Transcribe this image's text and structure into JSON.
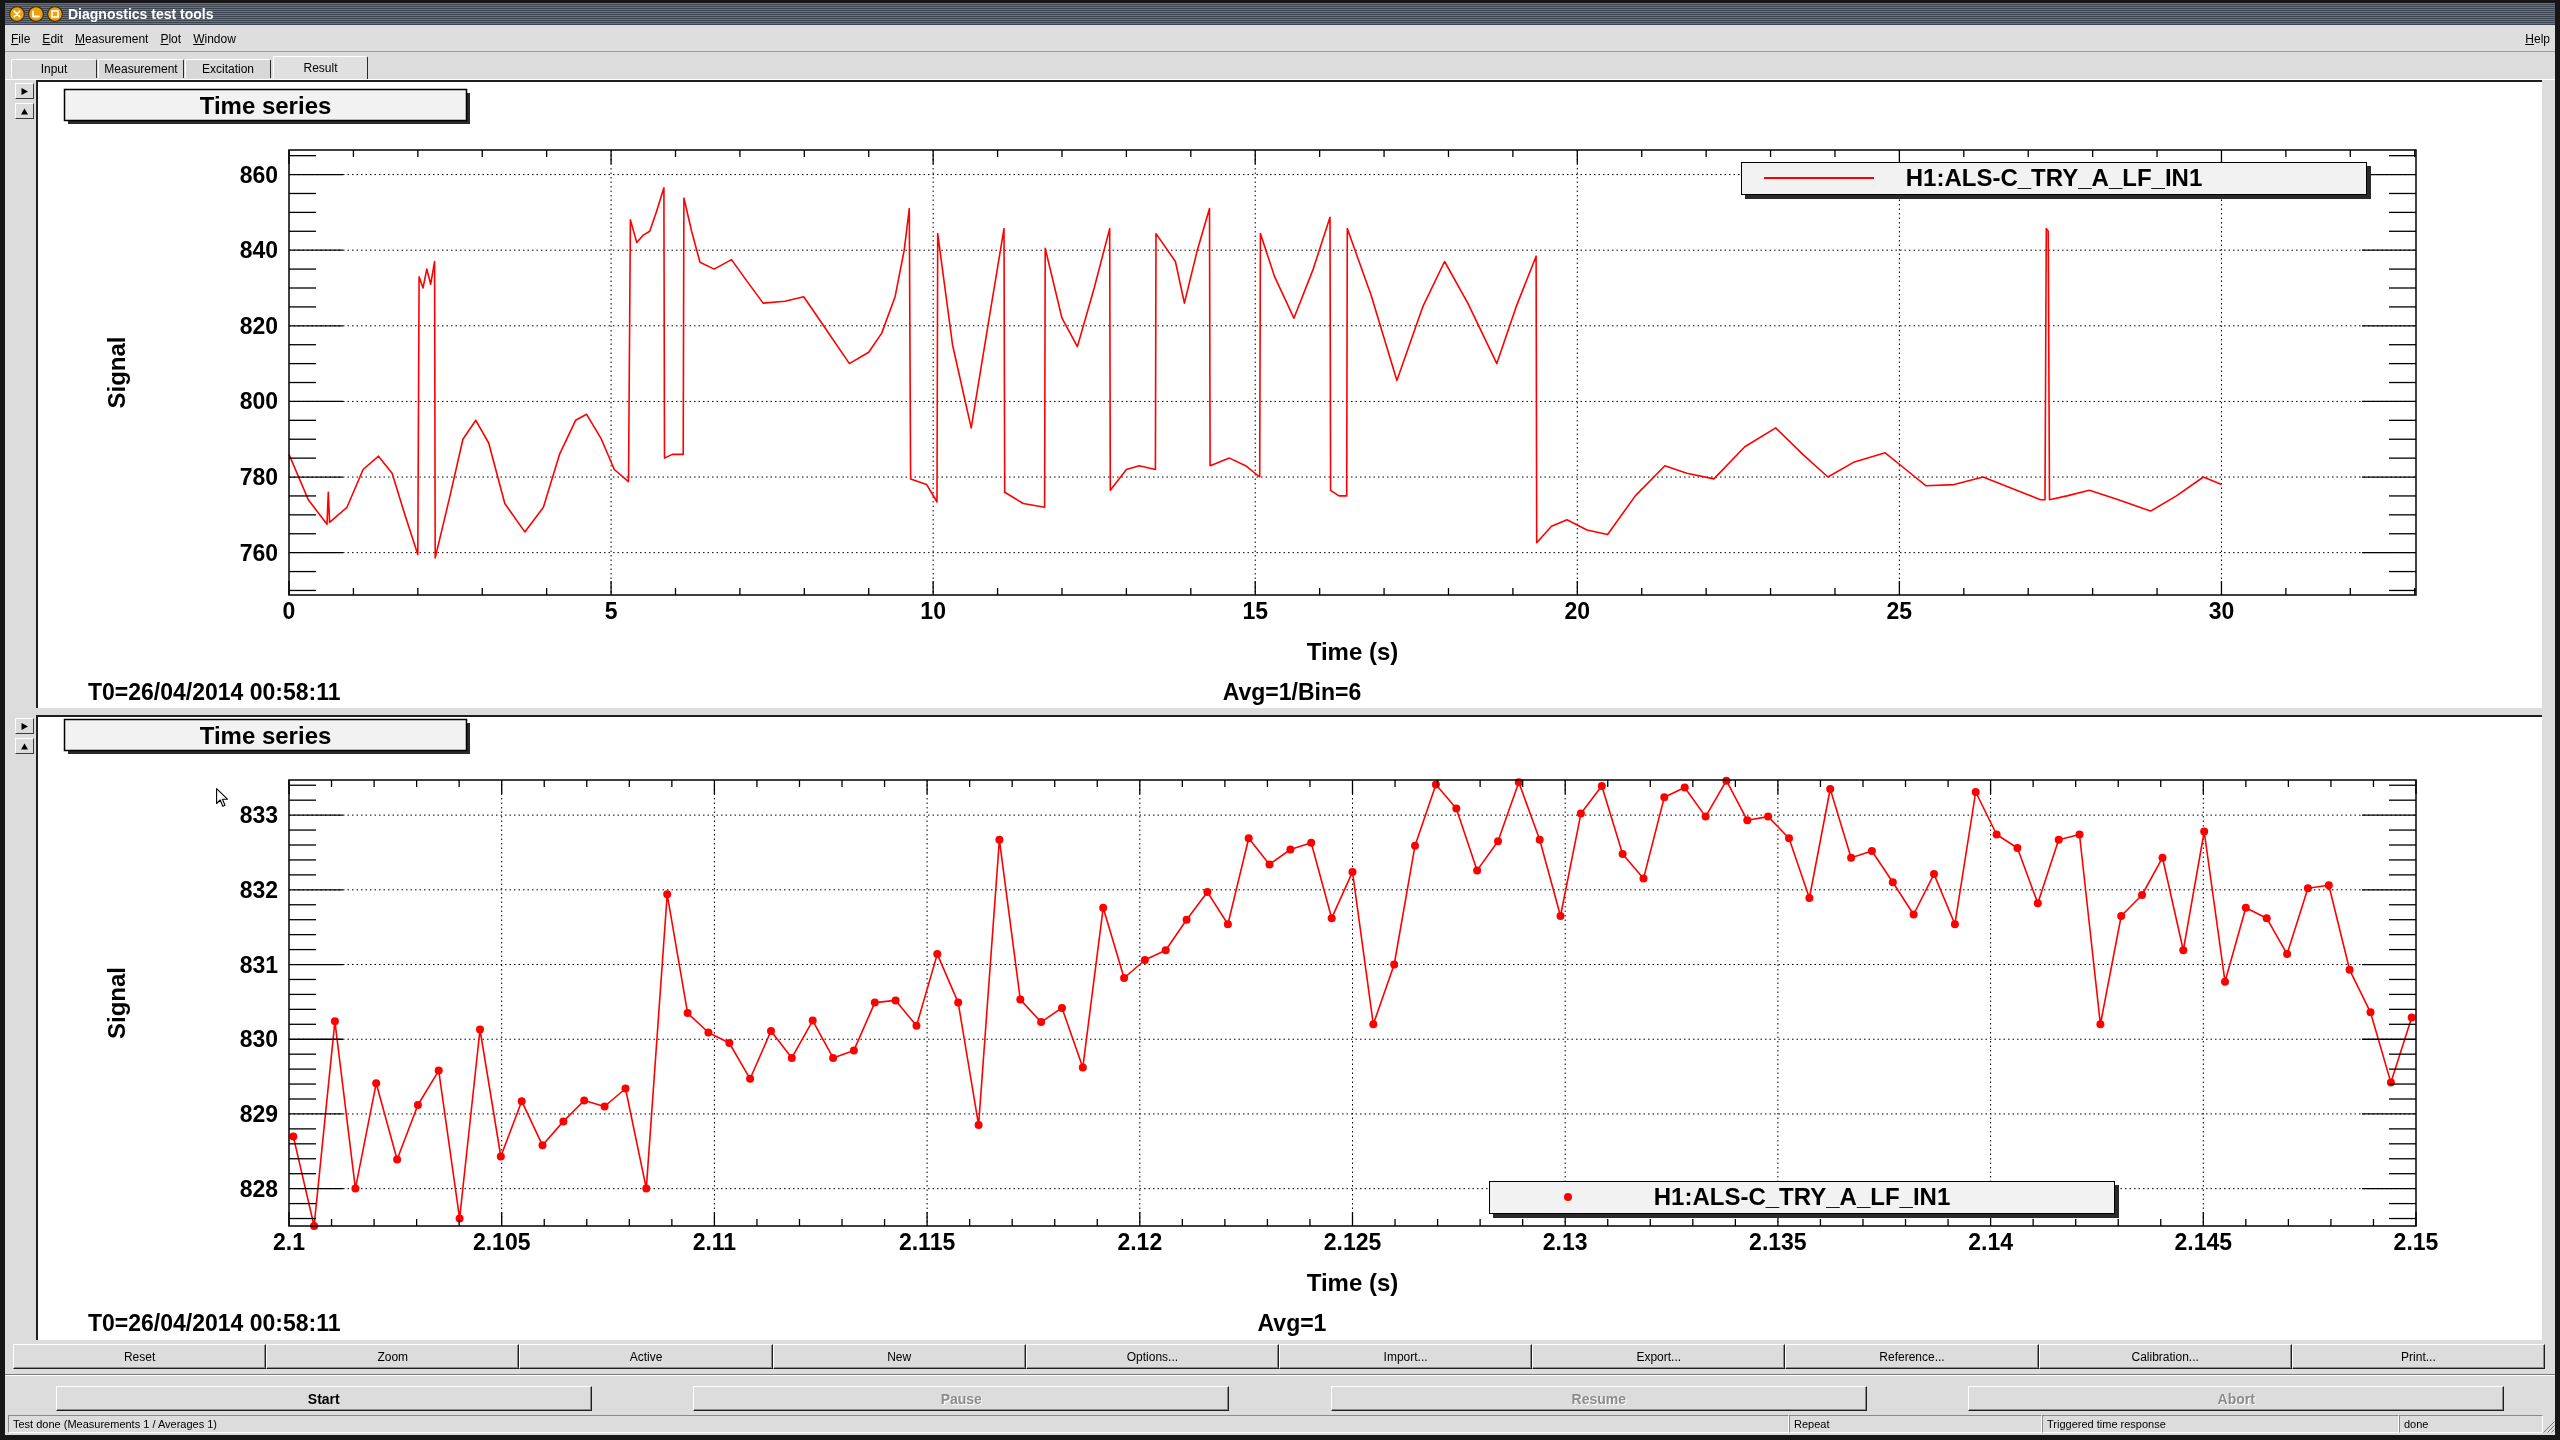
{
  "window": {
    "title": "Diagnostics test tools"
  },
  "menu": [
    "File",
    "Edit",
    "Measurement",
    "Plot",
    "Window"
  ],
  "help_menu": "Help",
  "tabs": [
    {
      "label": "Input",
      "selected": false
    },
    {
      "label": "Measurement",
      "selected": false
    },
    {
      "label": "Excitation",
      "selected": false
    },
    {
      "label": "Result",
      "selected": true
    }
  ],
  "plots": [
    {
      "start_time": "T0=26/04/2014 00:58:11",
      "averaging": "Avg=1/Bin=6",
      "chart_data": {
        "type": "line",
        "title": "Time series",
        "xlabel": "Time (s)",
        "ylabel": "Signal",
        "grid": true,
        "x": [
          0,
          0.3,
          0.59,
          0.61,
          0.63,
          0.9,
          1.15,
          1.39,
          1.6,
          1.8,
          2.0,
          2.02,
          2.08,
          2.14,
          2.2,
          2.26,
          2.27,
          2.5,
          2.7,
          2.9,
          3.1,
          3.35,
          3.66,
          3.95,
          4.2,
          4.45,
          4.62,
          4.85,
          5.05,
          5.27,
          5.3,
          5.4,
          5.5,
          5.6,
          5.7,
          5.82,
          5.83,
          5.95,
          6.12,
          6.13,
          6.25,
          6.38,
          6.6,
          6.87,
          7.1,
          7.36,
          7.7,
          7.99,
          8.3,
          8.7,
          9.0,
          9.2,
          9.41,
          9.55,
          9.63,
          9.65,
          9.9,
          10.06,
          10.07,
          10.3,
          10.59,
          10.85,
          11.1,
          11.11,
          11.4,
          11.73,
          11.74,
          12.0,
          12.24,
          12.5,
          12.74,
          12.75,
          13.0,
          13.2,
          13.45,
          13.46,
          13.76,
          13.9,
          14.1,
          14.29,
          14.3,
          14.6,
          14.85,
          15.07,
          15.08,
          15.3,
          15.6,
          15.9,
          16.16,
          16.17,
          16.3,
          16.42,
          16.43,
          16.8,
          17.2,
          17.6,
          17.94,
          18.3,
          18.75,
          19.05,
          19.36,
          19.37,
          19.6,
          19.84,
          20.15,
          20.47,
          20.9,
          21.36,
          21.7,
          22.12,
          22.6,
          23.08,
          23.5,
          23.89,
          24.3,
          24.78,
          25.1,
          25.41,
          25.85,
          26.3,
          26.75,
          27.19,
          27.26,
          27.28,
          27.31,
          27.33,
          27.6,
          27.95,
          28.4,
          28.9,
          29.3,
          29.72,
          30.0
        ],
        "series": [
          {
            "name": "H1:ALS-C_TRY_A_LF_IN1",
            "color": "#ff0000",
            "marker": "none",
            "values": [
              786,
              774,
              767.5,
              776,
              768,
              772,
              782,
              785.5,
              781,
              770,
              759.5,
              833,
              830,
              835,
              831,
              837,
              758.6,
              775,
              790,
              795,
              789,
              773,
              765.5,
              772,
              786,
              795,
              796.6,
              790,
              782,
              778.8,
              848,
              842,
              844,
              845,
              850,
              856.5,
              785,
              786,
              786,
              853.8,
              845,
              836.8,
              835,
              837.5,
              832,
              826,
              826.5,
              827.7,
              820,
              810,
              813,
              818,
              827.7,
              840,
              851,
              779.5,
              778,
              773.4,
              844.4,
              815,
              793,
              820,
              845.7,
              776,
              773,
              772,
              840.5,
              822,
              814.5,
              830,
              845.7,
              776.5,
              782,
              783,
              782,
              844.4,
              837,
              826,
              840,
              851,
              783,
              785,
              783,
              780,
              844.4,
              833,
              822,
              835,
              848.7,
              776.5,
              775,
              775,
              845.7,
              828,
              805.5,
              825,
              837,
              826,
              810,
              825,
              838.4,
              762.6,
              767,
              768.7,
              766,
              764.8,
              775,
              783,
              781,
              779.5,
              788,
              793,
              786,
              780,
              784,
              786.4,
              782,
              777.7,
              778,
              780,
              777,
              774,
              774,
              845.7,
              845,
              774,
              775,
              776.5,
              774,
              771,
              775,
              780,
              778
            ]
          }
        ],
        "xlim": [
          0,
          33.02
        ],
        "ylim": [
          748.8,
          866.5
        ],
        "xticks": [
          0,
          5,
          10,
          15,
          20,
          25,
          30
        ],
        "yticks": [
          760,
          780,
          800,
          820,
          840,
          860
        ]
      }
    },
    {
      "start_time": "T0=26/04/2014 00:58:11",
      "averaging": "Avg=1",
      "chart_data": {
        "type": "line",
        "title": "Time series",
        "xlabel": "Time (s)",
        "ylabel": "Signal",
        "grid": true,
        "x": [
          2.1001,
          2.10059,
          2.10108,
          2.10156,
          2.10205,
          2.10254,
          2.10303,
          2.10352,
          2.10401,
          2.10449,
          2.10498,
          2.10547,
          2.10596,
          2.10645,
          2.10694,
          2.10742,
          2.10791,
          2.1084,
          2.10889,
          2.10937,
          2.10986,
          2.11035,
          2.11084,
          2.11133,
          2.11182,
          2.11231,
          2.11279,
          2.11328,
          2.11377,
          2.11426,
          2.11475,
          2.11524,
          2.11573,
          2.11621,
          2.1167,
          2.11719,
          2.11768,
          2.11817,
          2.11866,
          2.11914,
          2.11963,
          2.12012,
          2.12061,
          2.1211,
          2.12159,
          2.12207,
          2.12256,
          2.12305,
          2.12354,
          2.12403,
          2.12451,
          2.125,
          2.12549,
          2.12598,
          2.12647,
          2.12696,
          2.12744,
          2.12793,
          2.12842,
          2.12891,
          2.1294,
          2.12989,
          2.13037,
          2.13086,
          2.13135,
          2.13184,
          2.13233,
          2.13281,
          2.1333,
          2.13379,
          2.13428,
          2.13477,
          2.13526,
          2.13574,
          2.13623,
          2.13672,
          2.13721,
          2.1377,
          2.13819,
          2.13867,
          2.13916,
          2.13965,
          2.14014,
          2.14063,
          2.14111,
          2.1416,
          2.14209,
          2.14258,
          2.14307,
          2.14356,
          2.14404,
          2.14453,
          2.14502,
          2.14551,
          2.146,
          2.14649,
          2.14697,
          2.14746,
          2.14795,
          2.14844,
          2.14893,
          2.14941,
          2.1499
        ],
        "series": [
          {
            "name": "H1:ALS-C_TRY_A_LF_IN1",
            "color": "#ff0000",
            "marker": "circle",
            "values": [
              828.7,
              827.5,
              830.24,
              828.0,
              829.41,
              828.39,
              829.12,
              829.58,
              827.6,
              830.13,
              828.43,
              829.17,
              828.58,
              828.9,
              829.18,
              829.1,
              829.34,
              828.0,
              831.94,
              830.35,
              830.09,
              829.95,
              829.47,
              830.11,
              829.75,
              830.25,
              829.75,
              829.85,
              830.49,
              830.52,
              830.18,
              831.14,
              830.49,
              828.85,
              832.67,
              830.53,
              830.23,
              830.42,
              829.62,
              831.76,
              830.82,
              831.06,
              831.19,
              831.6,
              831.97,
              831.54,
              832.69,
              832.34,
              832.54,
              832.63,
              831.62,
              832.24,
              830.2,
              831.0,
              832.59,
              833.41,
              833.09,
              832.26,
              832.65,
              833.44,
              832.67,
              831.65,
              833.02,
              833.39,
              832.48,
              832.15,
              833.24,
              833.37,
              832.98,
              833.46,
              832.93,
              832.98,
              832.69,
              831.89,
              833.35,
              832.43,
              832.52,
              832.1,
              831.67,
              832.21,
              831.54,
              833.31,
              832.74,
              832.56,
              831.82,
              832.67,
              832.74,
              830.2,
              831.65,
              831.93,
              832.43,
              831.19,
              832.78,
              830.77,
              831.76,
              831.62,
              831.14,
              832.02,
              832.06,
              830.93,
              830.36,
              829.42,
              830.29
            ]
          }
        ],
        "xlim": [
          2.1,
          2.15
        ],
        "ylim": [
          827.5,
          833.47
        ],
        "xticks": [
          2.1,
          2.105,
          2.11,
          2.115,
          2.12,
          2.125,
          2.13,
          2.135,
          2.14,
          2.145,
          2.15
        ],
        "yticks": [
          828,
          829,
          830,
          831,
          832,
          833
        ]
      }
    }
  ],
  "plot_buttons": [
    "Reset",
    "Zoom",
    "Active",
    "New",
    "Options...",
    "Import...",
    "Export...",
    "Reference...",
    "Calibration...",
    "Print..."
  ],
  "run_buttons": [
    {
      "label": "Start",
      "disabled": false
    },
    {
      "label": "Pause",
      "disabled": true
    },
    {
      "label": "Resume",
      "disabled": true
    },
    {
      "label": "Abort",
      "disabled": true
    }
  ],
  "status_bar": {
    "message": "Test done (Measurements 1 / Averages 1)",
    "fields": [
      "Repeat",
      "Triggered time response",
      "done"
    ]
  }
}
